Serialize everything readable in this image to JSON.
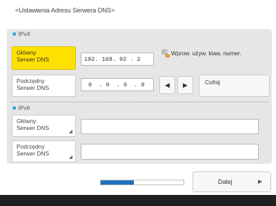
{
  "page": {
    "title": "<Ustawienia Adresu Serwera DNS>"
  },
  "ipv4": {
    "header": "IPv4",
    "primary": {
      "label_line1": "Główny",
      "label_line2": "Serwer DNS",
      "value": "192. 168. 92 . 2"
    },
    "secondary": {
      "label_line1": "Podrzędny",
      "label_line2": "Serwer DNS",
      "value": "0  . 0  . 0  . 0"
    }
  },
  "keypad_button": {
    "label": "Wprow. używ. klaw. numer.",
    "icon": "keypad-hand-icon"
  },
  "cursor_left": {
    "glyph": "◀"
  },
  "cursor_right": {
    "glyph": "▶"
  },
  "undo_button": {
    "label": "Cofnij"
  },
  "ipv6": {
    "header": "IPv6",
    "primary": {
      "label_line1": "Główny",
      "label_line2": "Serwer DNS",
      "value": ""
    },
    "secondary": {
      "label_line1": "Podrzędny",
      "label_line2": "Serwer DNS",
      "value": ""
    }
  },
  "progress": {
    "fraction": 0.4
  },
  "next_button": {
    "label": "Dalej",
    "glyph": "▶"
  },
  "colors": {
    "accent_yellow": "#ffe100",
    "progress_blue": "#1f6fbf",
    "bullet_blue": "#2aa7d8"
  }
}
